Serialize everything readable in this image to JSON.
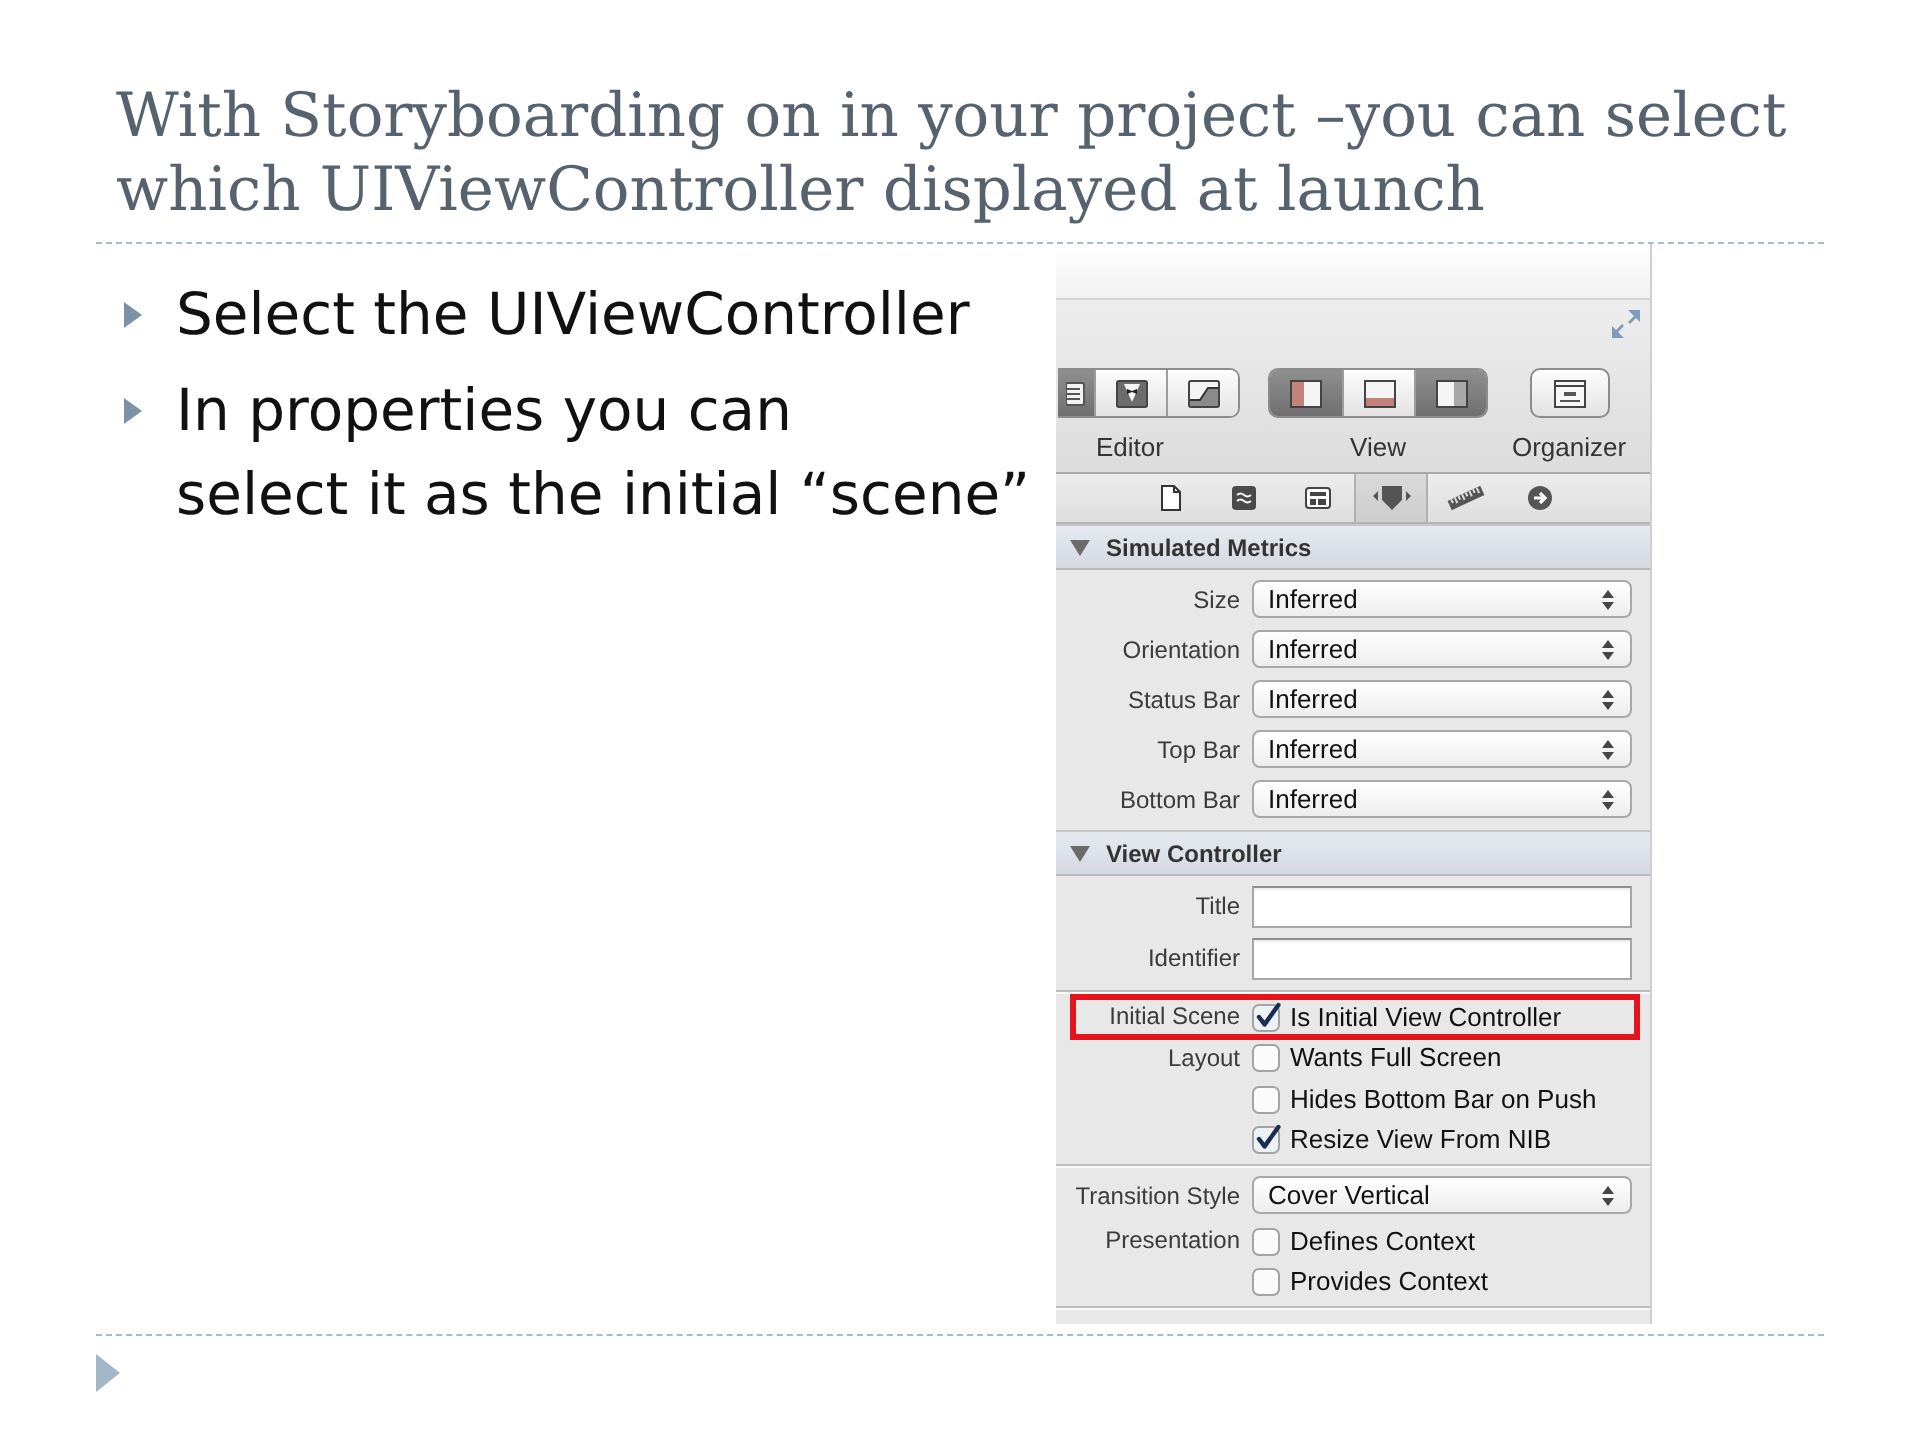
{
  "slide": {
    "title_lines": [
      "With Storyboarding on in your project –you can select",
      "which UIViewController displayed at launch"
    ],
    "bullets": [
      {
        "lines": [
          "Select the UIViewController"
        ]
      },
      {
        "lines": [
          "In properties you can",
          "select it as the initial “scene”"
        ]
      }
    ]
  },
  "inspector": {
    "toolbar": {
      "groups": [
        {
          "kind": "editor",
          "label": "Editor",
          "segments": [
            {
              "selected": true
            },
            {
              "selected": false
            },
            {
              "selected": false
            }
          ]
        },
        {
          "kind": "view",
          "label": "View",
          "segments": [
            {
              "on": true
            },
            {
              "on": false
            },
            {
              "on": true
            }
          ]
        },
        {
          "kind": "organizer",
          "label": "Organizer"
        }
      ]
    },
    "tabs": [
      {
        "selected": false
      },
      {
        "selected": false
      },
      {
        "selected": false
      },
      {
        "selected": true
      },
      {
        "selected": false
      },
      {
        "selected": false
      }
    ],
    "sections": [
      {
        "title": "Simulated Metrics",
        "expanded": true,
        "groups": [
          {
            "rows": [
              {
                "kind": "popup",
                "label": "Size",
                "value": "Inferred"
              },
              {
                "kind": "popup",
                "label": "Orientation",
                "value": "Inferred"
              },
              {
                "kind": "popup",
                "label": "Status Bar",
                "value": "Inferred"
              },
              {
                "kind": "popup",
                "label": "Top Bar",
                "value": "Inferred"
              },
              {
                "kind": "popup",
                "label": "Bottom Bar",
                "value": "Inferred"
              }
            ]
          }
        ]
      },
      {
        "title": "View Controller",
        "expanded": true,
        "groups": [
          {
            "rows": [
              {
                "kind": "text",
                "label": "Title"
              },
              {
                "kind": "text",
                "label": "Identifier"
              }
            ]
          },
          {
            "rows": [
              {
                "kind": "checkbox",
                "label": "Initial Scene",
                "text": "Is Initial View Controller",
                "checked": true,
                "highlighted": true
              },
              {
                "kind": "checkbox",
                "label": "Layout",
                "text": "Wants Full Screen",
                "checked": false,
                "highlighted": false
              },
              {
                "kind": "checkbox",
                "text": "Hides Bottom Bar on Push",
                "checked": false,
                "highlighted": false
              },
              {
                "kind": "checkbox",
                "text": "Resize View From NIB",
                "checked": true,
                "highlighted": false
              }
            ]
          },
          {
            "rows": [
              {
                "kind": "popup",
                "label": "Transition Style",
                "value": "Cover Vertical"
              },
              {
                "kind": "checkbox",
                "label": "Presentation",
                "text": "Defines Context",
                "checked": false,
                "highlighted": false
              },
              {
                "kind": "checkbox",
                "text": "Provides Context",
                "checked": false,
                "highlighted": false
              }
            ]
          }
        ]
      }
    ]
  }
}
